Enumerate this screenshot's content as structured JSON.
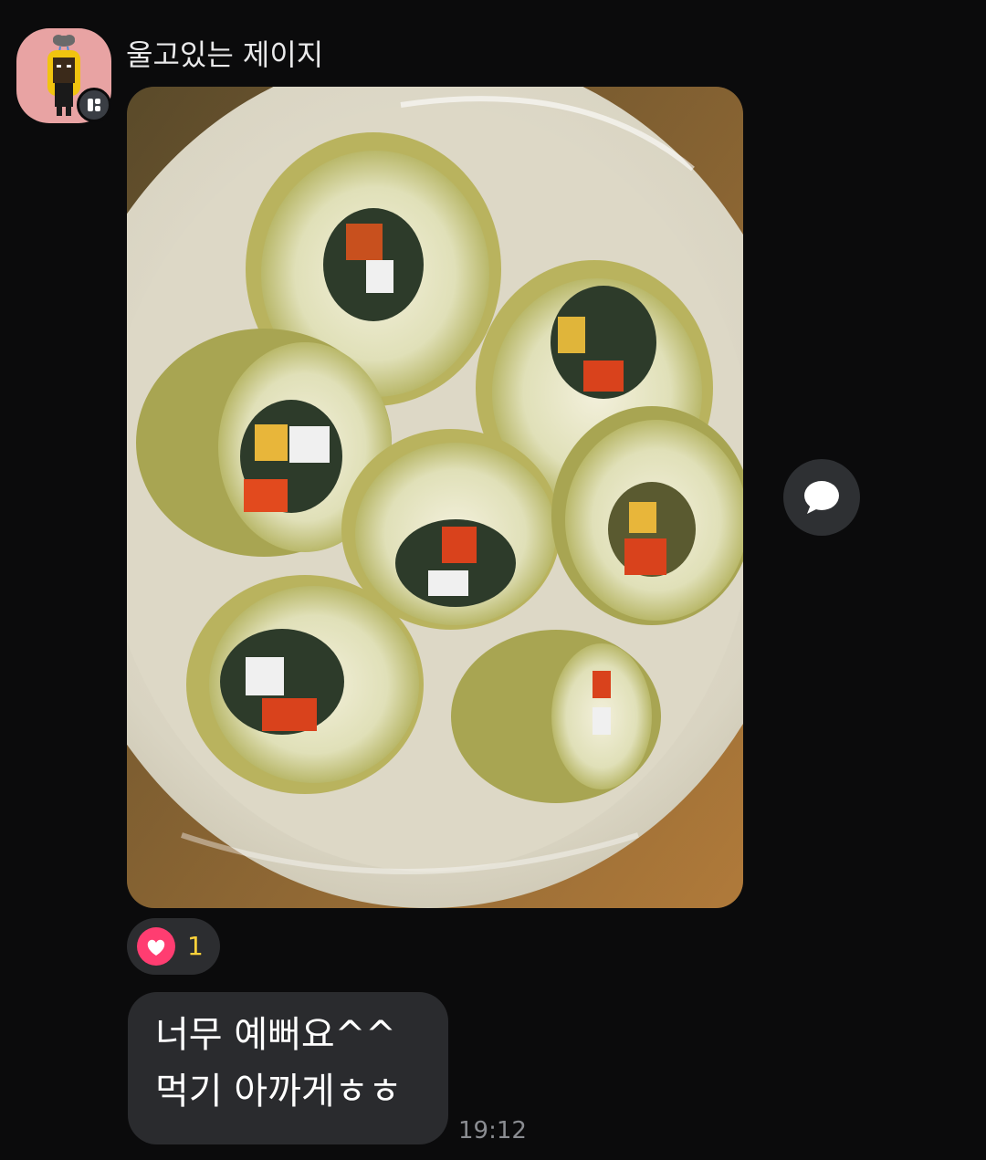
{
  "message": {
    "sender_name": "울고있는 제이지",
    "avatar_icon": "crying-character-avatar",
    "photo_subject": "photo-cucumber-kimchi-rolls",
    "reaction": {
      "icon": "heart-icon",
      "count": "1",
      "heart_color": "#ff3d71",
      "count_color": "#ffd23a"
    },
    "text_lines": [
      "너무 예뻐요^^",
      "먹기 아까게ㅎㅎ"
    ],
    "time": "19:12"
  },
  "actions": {
    "comment_icon": "speech-bubble-icon"
  }
}
